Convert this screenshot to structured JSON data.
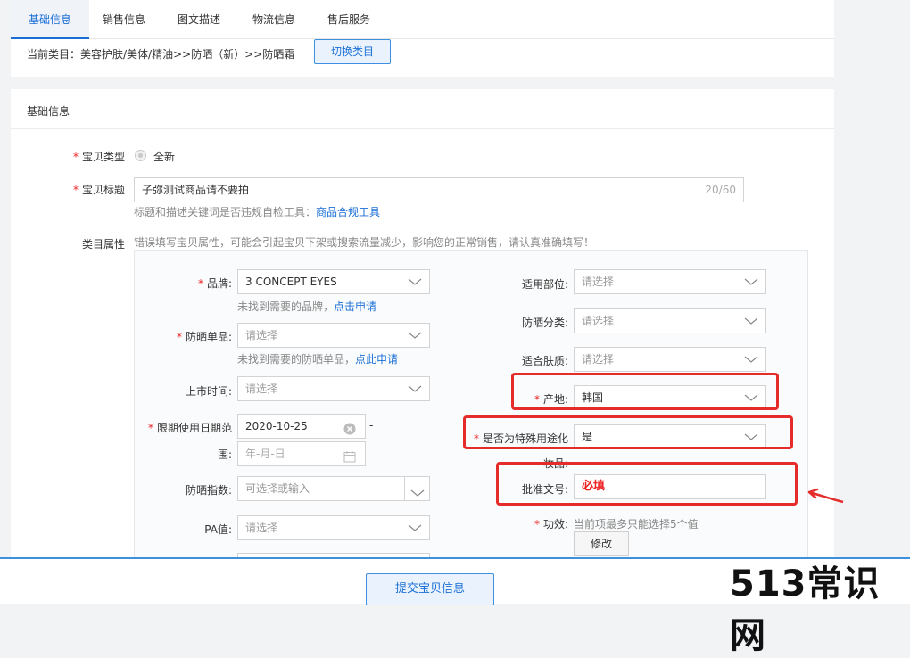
{
  "tabs": [
    "基础信息",
    "销售信息",
    "图文描述",
    "物流信息",
    "售后服务"
  ],
  "category": {
    "label": "当前类目：美容护肤/美体/精油>>防晒（新）>>防晒霜",
    "switch_button": "切换类目"
  },
  "section": {
    "title": "基础信息"
  },
  "item_type": {
    "label": "宝贝类型",
    "required": "*",
    "option": "全新"
  },
  "item_title": {
    "label": "宝贝标题",
    "required": "*",
    "value": "子弥测试商品请不要拍",
    "counter": "20/60",
    "hint_prefix": "标题和描述关键词是否违规自检工具：",
    "hint_link": "商品合规工具"
  },
  "category_attrs": {
    "label": "类目属性",
    "warning": "错误填写宝贝属性，可能会引起宝贝下架或搜索流量减少，影响您的正常销售，请认真准确填写！"
  },
  "left_fields": {
    "brand": {
      "required": "*",
      "label": "品牌:",
      "value": "3 CONCEPT EYES",
      "hint_prefix": "未找到需要的品牌，",
      "hint_link": "点击申请"
    },
    "sunscreen_item": {
      "required": "*",
      "label": "防晒单品:",
      "placeholder": "请选择",
      "hint_prefix": "未找到需要的防晒单品，",
      "hint_link": "点此申请"
    },
    "launch_time": {
      "label": "上市时间:",
      "placeholder": "请选择"
    },
    "expiry": {
      "required": "*",
      "label_line1": "限期使用日期范",
      "label_line2": "围:",
      "date_value": "2020-10-25",
      "dash": "-",
      "date_placeholder": "年-月-日"
    },
    "spf": {
      "label": "防晒指数:",
      "placeholder": "可选择或输入"
    },
    "pa": {
      "label": "PA值:",
      "placeholder": "请选择"
    }
  },
  "right_fields": {
    "apply_area": {
      "label": "适用部位:",
      "placeholder": "请选择"
    },
    "sunscreen_class": {
      "label": "防晒分类:",
      "placeholder": "请选择"
    },
    "skin_type": {
      "label": "适合肤质:",
      "placeholder": "请选择"
    },
    "origin": {
      "required": "*",
      "label": "产地:",
      "value": "韩国"
    },
    "special_use": {
      "required": "*",
      "label_line1": "是否为特殊用途化",
      "label_line2": "妆品:",
      "value": "是"
    },
    "approval_no": {
      "label": "批准文号:",
      "value": "必填"
    },
    "efficacy": {
      "required": "*",
      "label": "功效:",
      "hint": "当前项最多只能选择5个值",
      "button": "修改"
    }
  },
  "submit_button": "提交宝贝信息",
  "watermark": "513常识网",
  "colors": {
    "accent": "#1a6fd6",
    "highlight": "#e62b2b",
    "required": "#e22222"
  },
  "icons": [
    "chevron-down-icon",
    "clear-circle-icon",
    "calendar-icon",
    "red-arrow-icon"
  ]
}
